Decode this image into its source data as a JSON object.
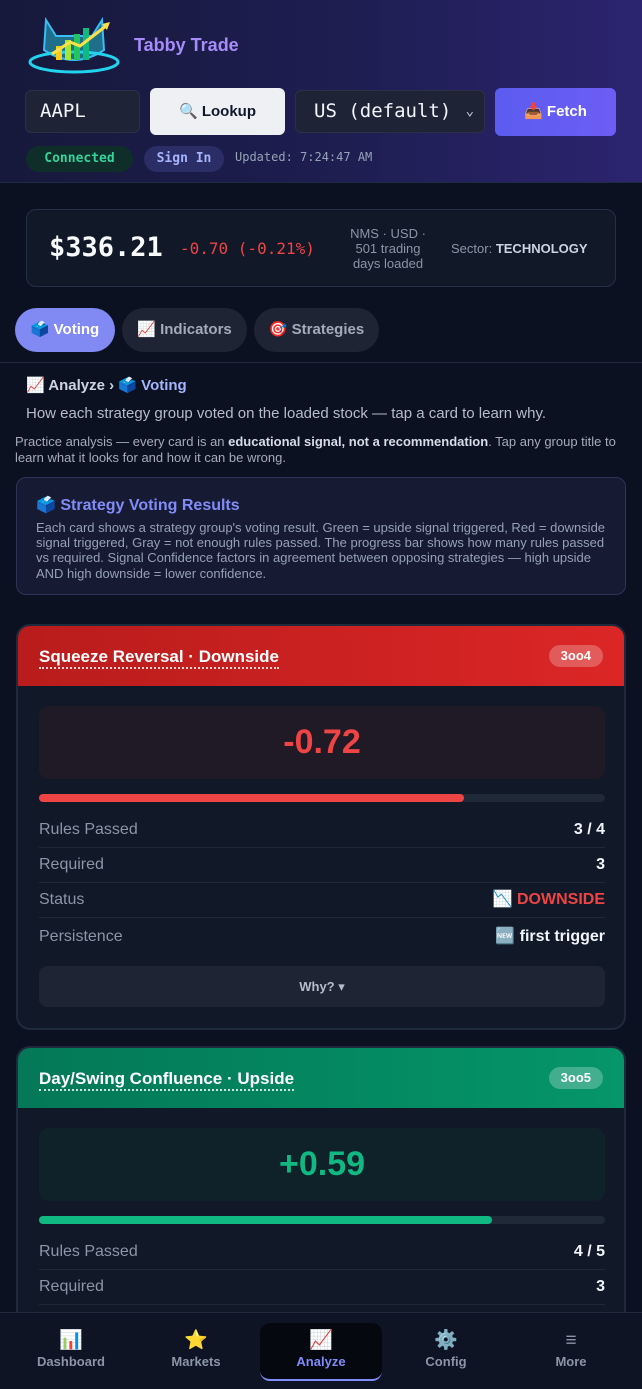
{
  "header": {
    "brand": "Tabby Trade",
    "ticker_value": "AAPL",
    "lookup_label": "🔍 Lookup",
    "market_value": "US (default)",
    "fetch_label": "📥 Fetch",
    "connected_label": "Connected",
    "signin_label": "Sign In",
    "updated_text": "Updated: 7:24:47 AM"
  },
  "quote": {
    "price": "$336.21",
    "change": "-0.70 (-0.21%)",
    "meta_line1": "NMS · USD ·",
    "meta_line2": "501 trading",
    "meta_line3": "days loaded",
    "sector_label": "Sector:",
    "sector_value": "TECHNOLOGY"
  },
  "tabs": [
    {
      "label": "🗳️ Voting"
    },
    {
      "label": "📈 Indicators"
    },
    {
      "label": "🎯 Strategies"
    }
  ],
  "breadcrumb": {
    "parent": "📈 Analyze",
    "sep": "›",
    "current": "🗳️ Voting"
  },
  "intro": "How each strategy group voted on the loaded stock — tap a card to learn why.",
  "practice": {
    "pre": "Practice analysis — every card is an ",
    "bold": "educational signal, not a recommendation",
    "post": ". Tap any group title to learn what it looks for and how it can be wrong."
  },
  "info": {
    "title": "🗳️ Strategy Voting Results",
    "body": "Each card shows a strategy group's voting result. Green = upside signal triggered, Red = downside signal triggered, Gray = not enough rules passed. The progress bar shows how many rules passed vs required. Signal Confidence factors in agreement between opposing strategies — high upside AND high downside = lower confidence."
  },
  "cards": [
    {
      "title": "Squeeze Reversal · Downside",
      "badge": "3oo4",
      "score": "-0.72",
      "progress": 0.75,
      "rules_label": "Rules Passed",
      "rules_value": "3 / 4",
      "required_label": "Required",
      "required_value": "3",
      "status_label": "Status",
      "status_value": "📉 DOWNSIDE",
      "persistence_label": "Persistence",
      "persistence_value": "🆕 first trigger",
      "why_label": "Why? ▾"
    },
    {
      "title": "Day/Swing Confluence · Upside",
      "badge": "3oo5",
      "score": "+0.59",
      "progress": 0.8,
      "rules_label": "Rules Passed",
      "rules_value": "4 / 5",
      "required_label": "Required",
      "required_value": "3"
    }
  ],
  "nav": [
    {
      "icon": "📊",
      "label": "Dashboard"
    },
    {
      "icon": "⭐",
      "label": "Markets"
    },
    {
      "icon": "📈",
      "label": "Analyze"
    },
    {
      "icon": "⚙️",
      "label": "Config"
    },
    {
      "icon": "≡",
      "label": "More"
    }
  ],
  "colors": {
    "accent": "#818cf8",
    "downside": "#ef4444",
    "upside": "#10b981"
  }
}
